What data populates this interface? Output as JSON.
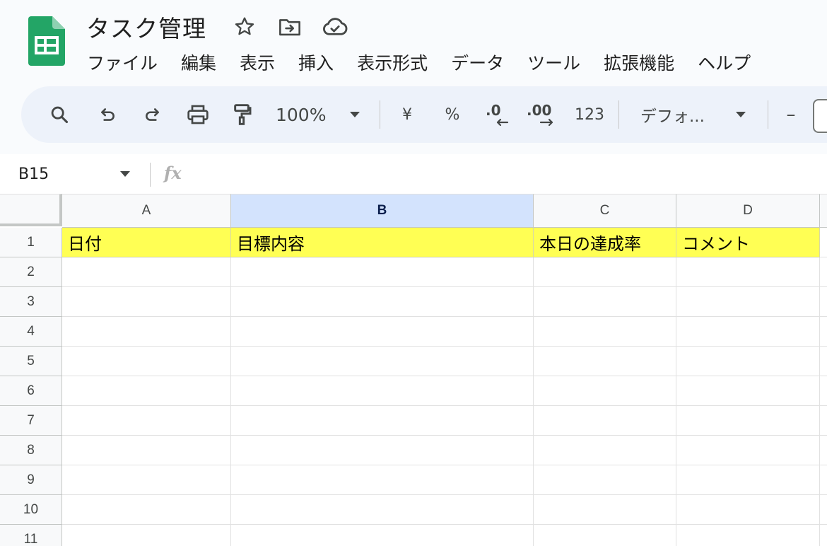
{
  "app": {
    "title": "タスク管理",
    "brand_color": "#0f9d58"
  },
  "title_icons": [
    "star-icon",
    "move-to-folder-icon",
    "cloud-saved-icon"
  ],
  "menu": {
    "items": [
      "ファイル",
      "編集",
      "表示",
      "挿入",
      "表示形式",
      "データ",
      "ツール",
      "拡張機能",
      "ヘルプ"
    ]
  },
  "toolbar": {
    "zoom": "100%",
    "currency": "¥",
    "percent": "%",
    "decrease_decimal": ".0",
    "increase_decimal": ".00",
    "number_format": "123",
    "font": "デフォ...",
    "font_size_minus": "–",
    "icons": [
      "search-icon",
      "undo-icon",
      "redo-icon",
      "print-icon",
      "paint-format-icon"
    ]
  },
  "formula_bar": {
    "cell_ref": "B15",
    "fx": "fx",
    "formula": ""
  },
  "sheet": {
    "selected_column": "B",
    "columns": [
      "A",
      "B",
      "C",
      "D"
    ],
    "rows": [
      "1",
      "2",
      "3",
      "4",
      "5",
      "6",
      "7",
      "8",
      "9",
      "10",
      "11"
    ],
    "header_row": [
      "日付",
      "目標内容",
      "本日の達成率",
      "コメント"
    ],
    "header_fill": "#ffff54"
  }
}
